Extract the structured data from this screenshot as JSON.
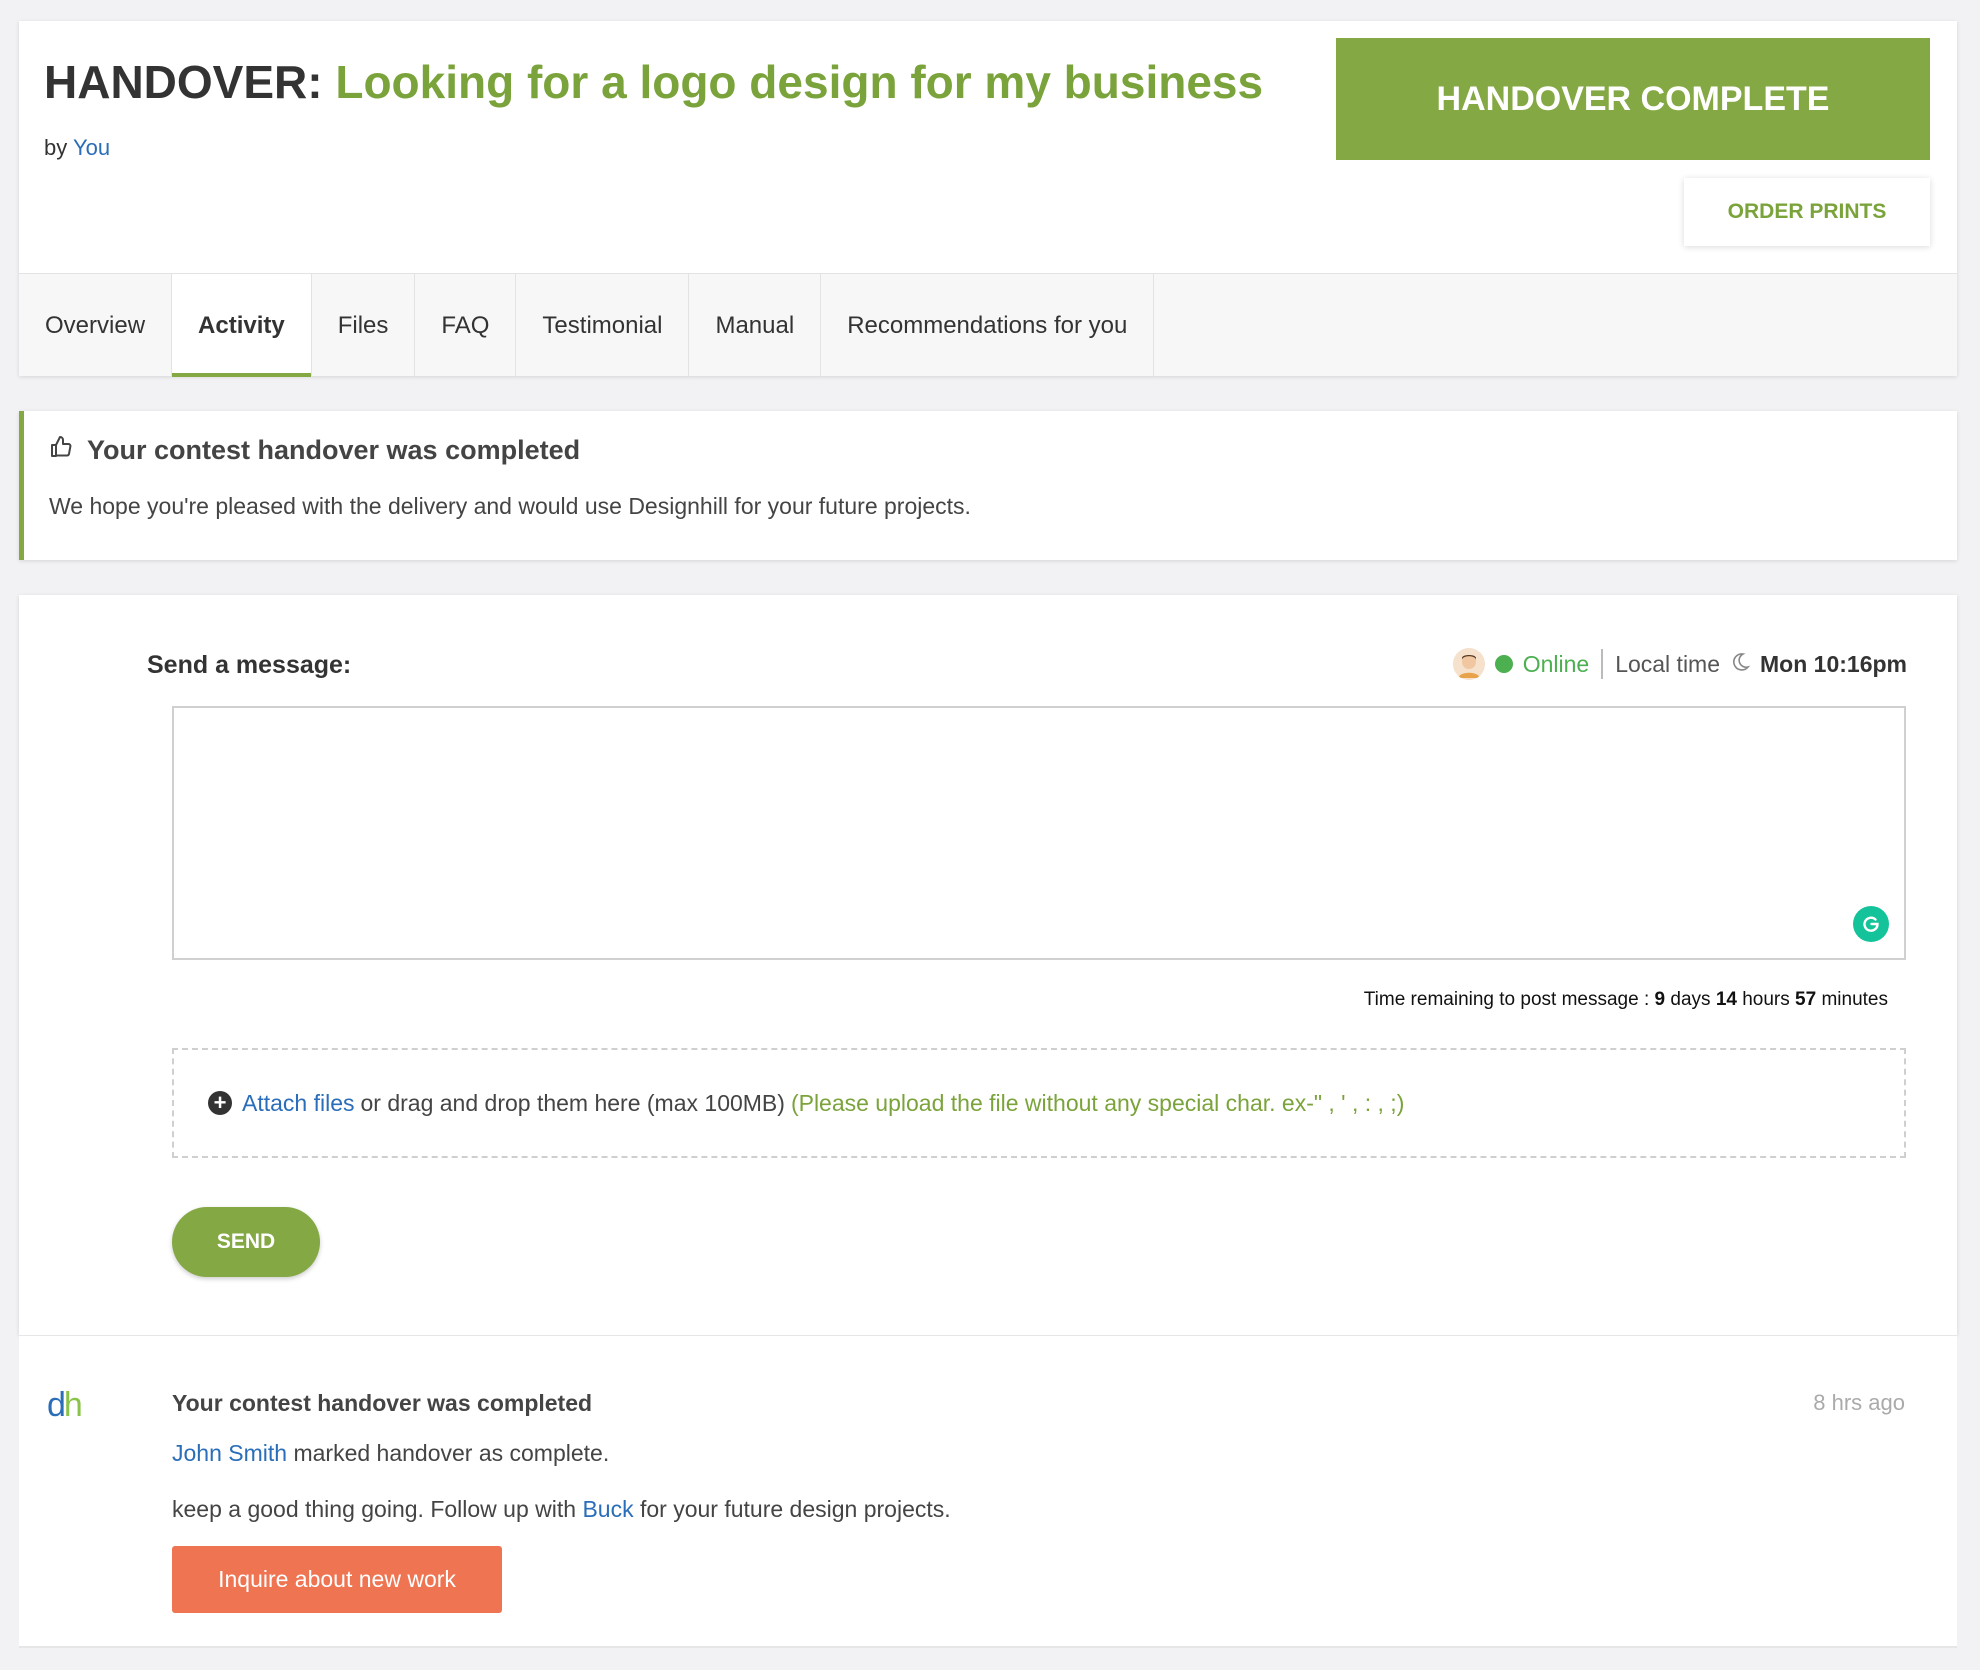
{
  "header": {
    "title_prefix": "HANDOVER:",
    "title": "Looking for a logo design for my business",
    "by_label": "by",
    "by_user": "You",
    "handover_button": "HANDOVER COMPLETE",
    "order_prints_button": "ORDER PRINTS"
  },
  "tabs": [
    {
      "label": "Overview",
      "active": false
    },
    {
      "label": "Activity",
      "active": true
    },
    {
      "label": "Files",
      "active": false
    },
    {
      "label": "FAQ",
      "active": false
    },
    {
      "label": "Testimonial",
      "active": false
    },
    {
      "label": "Manual",
      "active": false
    },
    {
      "label": "Recommendations for you",
      "active": false
    }
  ],
  "notice": {
    "icon": "thumbs-up-icon",
    "title": "Your contest handover was completed",
    "text": "We hope you're pleased with the delivery and would use Designhill for your future projects."
  },
  "message": {
    "label": "Send a message:",
    "status": "Online",
    "local_time_label": "Local time",
    "local_time": "Mon 10:16pm",
    "textarea_value": "",
    "remaining_label": "Time remaining to post message :",
    "remaining_days": "9",
    "days_label": "days",
    "remaining_hours": "14",
    "hours_label": "hours",
    "remaining_minutes": "57",
    "minutes_label": "minutes",
    "attach_link": "Attach files",
    "attach_text": "or drag and drop them here (max 100MB)",
    "attach_note": "(Please upload the file without any special char. ex-\" , ' , : , ;)",
    "send_button": "SEND"
  },
  "activity": {
    "logo_d": "d",
    "logo_h": "h",
    "title": "Your contest handover was completed",
    "time": "8 hrs ago",
    "user": "John Smith",
    "line1_text": "marked handover as complete.",
    "line2_prefix": "keep a good thing going. Follow up with",
    "line2_user": "Buck",
    "line2_suffix": "for your future design projects.",
    "inquire_button": "Inquire about new work"
  },
  "colors": {
    "brand_green": "#84a843",
    "link_blue": "#2a6db8",
    "online_green": "#4caf50",
    "cta_orange": "#ee7452"
  }
}
